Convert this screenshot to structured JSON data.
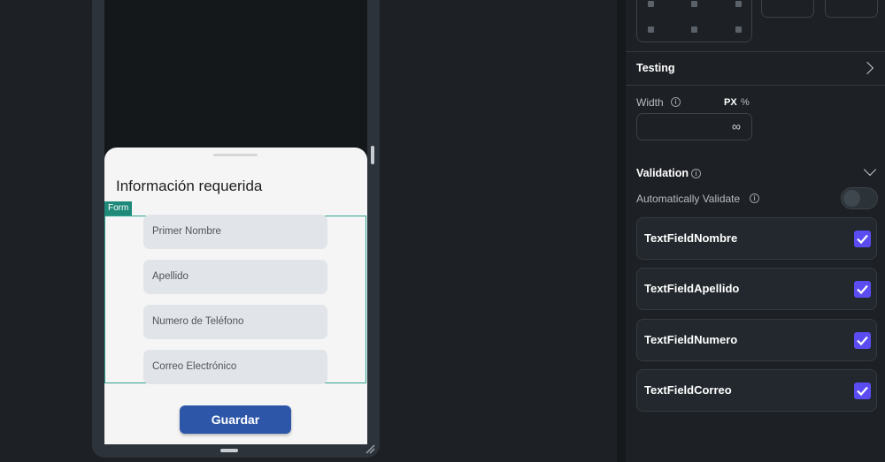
{
  "canvas": {
    "sheet": {
      "title": "Información requerida",
      "form_tag": "Form",
      "fields": [
        {
          "placeholder": "Primer Nombre"
        },
        {
          "placeholder": "Apellido"
        },
        {
          "placeholder": "Numero de Teléfono"
        },
        {
          "placeholder": "Correo Electrónico"
        }
      ],
      "save_label": "Guardar"
    }
  },
  "panel": {
    "testing": {
      "label": "Testing"
    },
    "width": {
      "label": "Width",
      "unit_px": "PX",
      "unit_percent": "%",
      "value": "∞"
    },
    "validation": {
      "label": "Validation",
      "auto_validate_label": "Automatically Validate",
      "auto_validate_on": false,
      "fields": [
        {
          "name": "TextFieldNombre",
          "checked": true
        },
        {
          "name": "TextFieldApellido",
          "checked": true
        },
        {
          "name": "TextFieldNumero",
          "checked": true
        },
        {
          "name": "TextFieldCorreo",
          "checked": true
        }
      ]
    }
  },
  "colors": {
    "accent_check": "#5a4cf0",
    "form_outline": "#2fa38f",
    "save_button": "#2d56a8"
  }
}
